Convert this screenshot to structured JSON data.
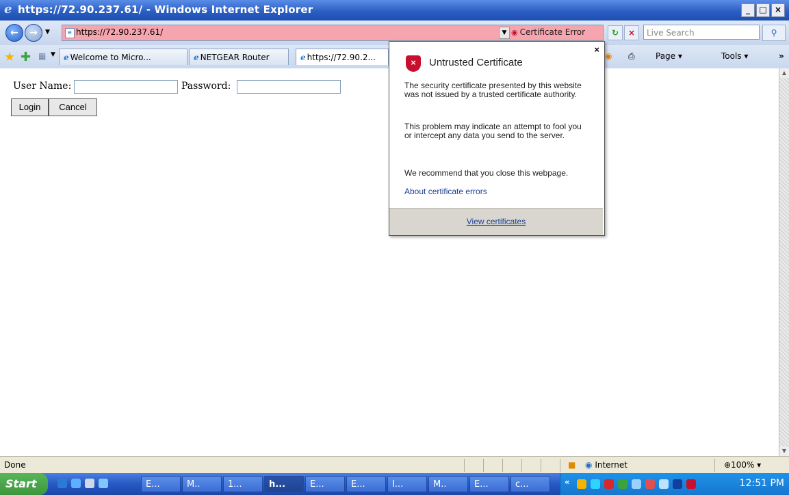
{
  "window": {
    "title": "https://72.90.237.61/ - Windows Internet Explorer",
    "controls": [
      "_",
      "×"
    ]
  },
  "address_bar": {
    "url": "https://72.90.237.61/",
    "certificate_error": "Certificate Error",
    "search_placeholder": "Live Search"
  },
  "tabs": [
    {
      "label": "Welcome to Micro..."
    },
    {
      "label": "NETGEAR Router"
    },
    {
      "label": "https://72.90.2..."
    }
  ],
  "command_bar": {
    "page": "Page ▾",
    "tools": "Tools ▾"
  },
  "form": {
    "username_label": "User Name:",
    "password_label": "Password:",
    "login_button": "Login",
    "cancel_button": "Cancel"
  },
  "popup": {
    "title": "Untrusted Certificate",
    "close": "×",
    "paragraph1": "The security certificate presented by this website was not issued by a trusted certificate authority.",
    "paragraph2": "This problem may indicate an attempt to fool you or intercept any data you send to the server.",
    "paragraph3": "We recommend that you close this webpage.",
    "about_link": "About certificate errors",
    "view_certificates": "View certificates"
  },
  "status_bar": {
    "status": "Done",
    "zone": "Internet",
    "zoom": "⊕100% ▾"
  },
  "taskbar": {
    "start": "Start",
    "buttons": [
      {
        "label": "E..."
      },
      {
        "label": "M.."
      },
      {
        "label": "1..."
      },
      {
        "label": "h..."
      },
      {
        "label": "E..."
      },
      {
        "label": "E..."
      },
      {
        "label": "I..."
      },
      {
        "label": "M.."
      },
      {
        "label": "E..."
      },
      {
        "label": "c..."
      }
    ],
    "clock": "12:51 PM"
  },
  "colors": {
    "address_error_bg": "#f6a4ad",
    "link": "#1c3f95",
    "shield_red": "#c8102e"
  }
}
